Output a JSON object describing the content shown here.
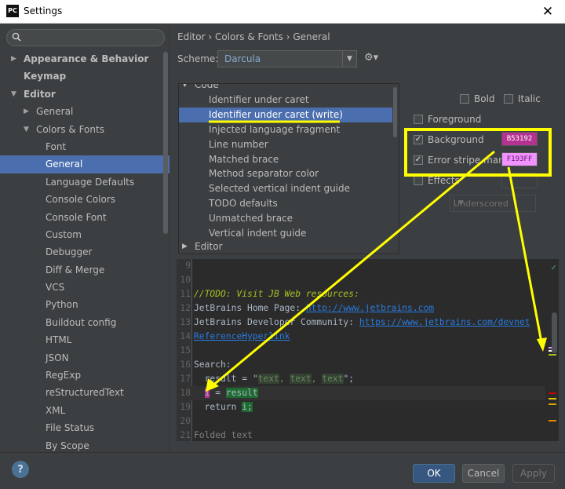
{
  "window": {
    "title": "Settings",
    "logo": "PC"
  },
  "search": {
    "placeholder": "",
    "value": ""
  },
  "tree": [
    {
      "label": "Appearance & Behavior",
      "indent": 0,
      "arrow": "▶",
      "bold": true,
      "selected": false
    },
    {
      "label": "Keymap",
      "indent": 0,
      "arrow": "",
      "bold": true,
      "selected": false
    },
    {
      "label": "Editor",
      "indent": 0,
      "arrow": "▼",
      "bold": true,
      "selected": false
    },
    {
      "label": "General",
      "indent": 1,
      "arrow": "▶",
      "bold": false,
      "selected": false
    },
    {
      "label": "Colors & Fonts",
      "indent": 1,
      "arrow": "▼",
      "bold": false,
      "selected": false
    },
    {
      "label": "Font",
      "indent": 2,
      "arrow": "",
      "bold": false,
      "selected": false
    },
    {
      "label": "General",
      "indent": 2,
      "arrow": "",
      "bold": false,
      "selected": true
    },
    {
      "label": "Language Defaults",
      "indent": 2,
      "arrow": "",
      "bold": false,
      "selected": false
    },
    {
      "label": "Console Colors",
      "indent": 2,
      "arrow": "",
      "bold": false,
      "selected": false
    },
    {
      "label": "Console Font",
      "indent": 2,
      "arrow": "",
      "bold": false,
      "selected": false
    },
    {
      "label": "Custom",
      "indent": 2,
      "arrow": "",
      "bold": false,
      "selected": false
    },
    {
      "label": "Debugger",
      "indent": 2,
      "arrow": "",
      "bold": false,
      "selected": false
    },
    {
      "label": "Diff & Merge",
      "indent": 2,
      "arrow": "",
      "bold": false,
      "selected": false
    },
    {
      "label": "VCS",
      "indent": 2,
      "arrow": "",
      "bold": false,
      "selected": false
    },
    {
      "label": "Python",
      "indent": 2,
      "arrow": "",
      "bold": false,
      "selected": false
    },
    {
      "label": "Buildout config",
      "indent": 2,
      "arrow": "",
      "bold": false,
      "selected": false
    },
    {
      "label": "HTML",
      "indent": 2,
      "arrow": "",
      "bold": false,
      "selected": false
    },
    {
      "label": "JSON",
      "indent": 2,
      "arrow": "",
      "bold": false,
      "selected": false
    },
    {
      "label": "RegExp",
      "indent": 2,
      "arrow": "",
      "bold": false,
      "selected": false
    },
    {
      "label": "reStructuredText",
      "indent": 2,
      "arrow": "",
      "bold": false,
      "selected": false
    },
    {
      "label": "XML",
      "indent": 2,
      "arrow": "",
      "bold": false,
      "selected": false
    },
    {
      "label": "File Status",
      "indent": 2,
      "arrow": "",
      "bold": false,
      "selected": false
    },
    {
      "label": "By Scope",
      "indent": 2,
      "arrow": "",
      "bold": false,
      "selected": false
    }
  ],
  "breadcrumb": "Editor › Colors & Fonts › General",
  "scheme": {
    "label": "Scheme:",
    "value": "Darcula"
  },
  "attributes": {
    "group_code": "Code",
    "items": [
      "Identifier under caret",
      "Identifier under caret (write)",
      "Injected language fragment",
      "Line number",
      "Matched brace",
      "Method separator color",
      "Selected vertical indent guide",
      "TODO defaults",
      "Unmatched brace",
      "Vertical indent guide"
    ],
    "selected_index": 1,
    "group_editor": "Editor"
  },
  "props": {
    "bold": {
      "label": "Bold",
      "checked": false
    },
    "italic": {
      "label": "Italic",
      "checked": false
    },
    "foreground": {
      "label": "Foreground",
      "checked": false
    },
    "background": {
      "label": "Background",
      "checked": true,
      "value": "B53192",
      "color": "#b53192"
    },
    "error_stripe": {
      "label": "Error stripe mark",
      "checked": true,
      "value": "F193FF",
      "color": "#f193ff"
    },
    "effects": {
      "label": "Effects",
      "checked": false,
      "type": "Underscored"
    }
  },
  "editor": {
    "lines": {
      "l9": "9",
      "l10": "10",
      "l11": "11",
      "l11_text": "//TODO: Visit JB Web resources:",
      "l12": "12",
      "l12_text": "JetBrains Home Page: ",
      "l12_link": "http://www.jetbrains.com",
      "l13": "13",
      "l13_text": "JetBrains Developer Community: ",
      "l13_link": "https://www.jetbrains.com/devnet",
      "l14": "14",
      "l14_link": "ReferenceHyperlink",
      "l15": "15",
      "l16": "16",
      "l16_text": "Search:",
      "l17": "17",
      "l17_a": "  result = \"",
      "l17_t1": "text",
      "l17_s1": ", ",
      "l17_t2": "text",
      "l17_s2": ", ",
      "l17_t3": "text",
      "l17_b": "\";",
      "l18": "18",
      "l18_a": "  ",
      "l18_i": "i",
      "l18_b": " = ",
      "l18_r": "result",
      "l19": "19",
      "l19_a": "  return ",
      "l19_i": "i;",
      "l20": "20",
      "l21": "21",
      "l21_text": "Folded text"
    }
  },
  "buttons": {
    "ok": "OK",
    "cancel": "Cancel",
    "apply": "Apply",
    "help": "?"
  }
}
